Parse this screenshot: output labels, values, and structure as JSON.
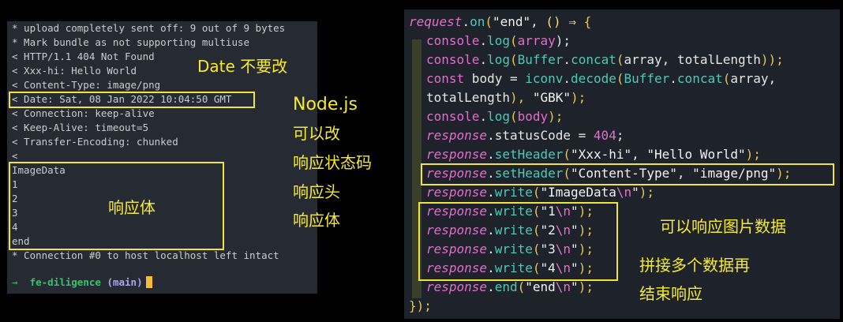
{
  "terminal": {
    "lines": [
      "* upload completely sent off: 9 out of 9 bytes",
      "* Mark bundle as not supporting multiuse",
      "< HTTP/1.1 404 Not Found",
      "< Xxx-hi: Hello World",
      "< Content-Type: image/png",
      "< Date: Sat, 08 Jan 2022 10:04:50 GMT",
      "< Connection: keep-alive",
      "< Keep-Alive: timeout=5",
      "< Transfer-Encoding: chunked",
      "<",
      "ImageData",
      "1",
      "2",
      "3",
      "4",
      "end",
      "* Connection #0 to host localhost left intact",
      "→",
      "fe-diligence",
      "(main)"
    ]
  },
  "annotations": {
    "date_note": "Date 不要改",
    "node_note": "Node.js",
    "node_note_2": "可以改",
    "node_note_3": "响应状态码",
    "node_note_4": "响应头",
    "node_note_5": "响应体",
    "body_note": "响应体",
    "image_note": "可以响应图片数据",
    "concat_note": "拼接多个数据再",
    "concat_note_2": "结束响应"
  },
  "code": {
    "l1": [
      "request",
      ".",
      "on",
      "(",
      "\"end\"",
      ", ",
      "()",
      " ⇒ ",
      "{"
    ],
    "l2": [
      "console",
      ".",
      "log",
      "(",
      "array",
      ");"
    ],
    "l3": [
      "console",
      ".",
      "log",
      "(",
      "Buffer",
      ".",
      "concat",
      "(",
      "array, totalLength",
      "));"
    ],
    "l4": [
      "const",
      " body = ",
      "iconv",
      ".",
      "decode",
      "(",
      "Buffer",
      ".",
      "concat",
      "(",
      "array,"
    ],
    "l5": [
      "totalLength",
      "), ",
      "\"GBK\"",
      ");"
    ],
    "l6": [
      "console",
      ".",
      "log",
      "(",
      "body",
      ");"
    ],
    "l7": [
      "response",
      ".statusCode = ",
      "404",
      ";"
    ],
    "l8": [
      "response",
      ".",
      "setHeader",
      "(",
      "\"Xxx-hi\"",
      ", ",
      "\"Hello World\"",
      ");"
    ],
    "l9": [
      "response",
      ".",
      "setHeader",
      "(",
      "\"Content-Type\"",
      ", ",
      "\"image/png\"",
      ");"
    ],
    "l10": [
      "response",
      ".",
      "write",
      "(",
      "\"ImageData",
      "\\n",
      "\"",
      ");"
    ],
    "l11": [
      "response",
      ".",
      "write",
      "(",
      "\"1",
      "\\n",
      "\"",
      ");"
    ],
    "l12": [
      "response",
      ".",
      "write",
      "(",
      "\"2",
      "\\n",
      "\"",
      ");"
    ],
    "l13": [
      "response",
      ".",
      "write",
      "(",
      "\"3",
      "\\n",
      "\"",
      ");"
    ],
    "l14": [
      "response",
      ".",
      "write",
      "(",
      "\"4",
      "\\n",
      "\"",
      ");"
    ],
    "l15": [
      "response",
      ".",
      "end",
      "(",
      "\"end",
      "\\n",
      "\"",
      ");"
    ],
    "l16": [
      "}",
      ");"
    ]
  }
}
